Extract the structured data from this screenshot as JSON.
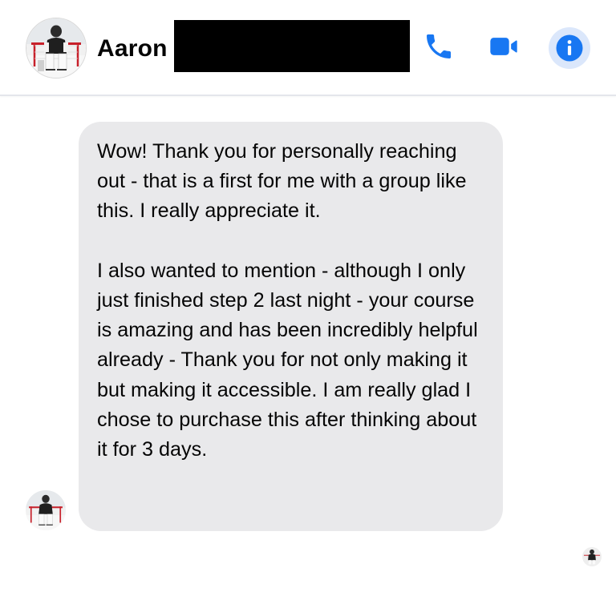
{
  "header": {
    "contact_name": "Aaron",
    "avatar_icon": "profile-photo-hockey-goalie-icon",
    "actions": [
      {
        "name": "audio-call",
        "icon": "phone-icon"
      },
      {
        "name": "video-call",
        "icon": "video-camera-icon"
      },
      {
        "name": "conversation-info",
        "icon": "info-icon"
      }
    ],
    "accent_color": "#1877f2"
  },
  "conversation": {
    "messages": [
      {
        "sender": "Aaron",
        "paragraphs": [
          "Wow! Thank you for personally reaching out - that is a first for me with a group like this. I really appreciate it.",
          "I also wanted to mention - although I only just finished step 2 last night - your course is amazing and has been incredibly helpful already - Thank you for not only making it but making it accessible. I am really glad I chose to purchase this after thinking about it for 3 days."
        ],
        "bubble_color": "#e9e9eb"
      }
    ],
    "seen_indicator_icon": "seen-avatar-icon"
  }
}
